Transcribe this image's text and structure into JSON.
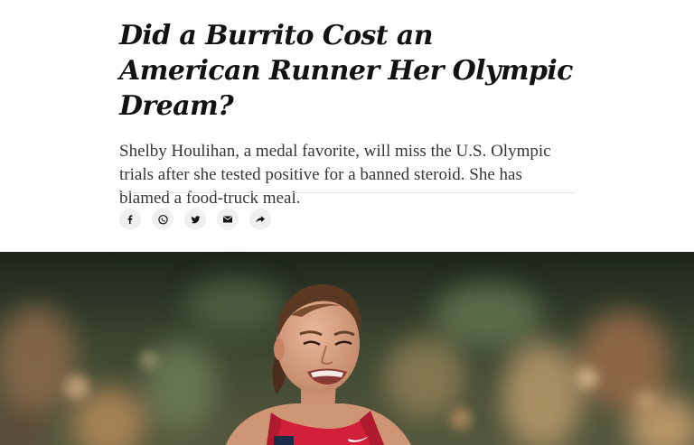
{
  "article": {
    "headline": "Did a Burrito Cost an American Runner Her Olympic Dream?",
    "summary": "Shelby Houlihan, a medal favorite, will miss the U.S. Olympic trials after she tested positive for a banned steroid. She has blamed a food-truck meal."
  },
  "share": {
    "buttons": [
      {
        "icon": "facebook-icon"
      },
      {
        "icon": "whatsapp-icon"
      },
      {
        "icon": "twitter-icon"
      },
      {
        "icon": "email-icon"
      },
      {
        "icon": "share-icon"
      }
    ]
  },
  "photo": {
    "subject": "runner",
    "colors": {
      "jersey": "#d3203a",
      "background": "#3a4228"
    }
  }
}
